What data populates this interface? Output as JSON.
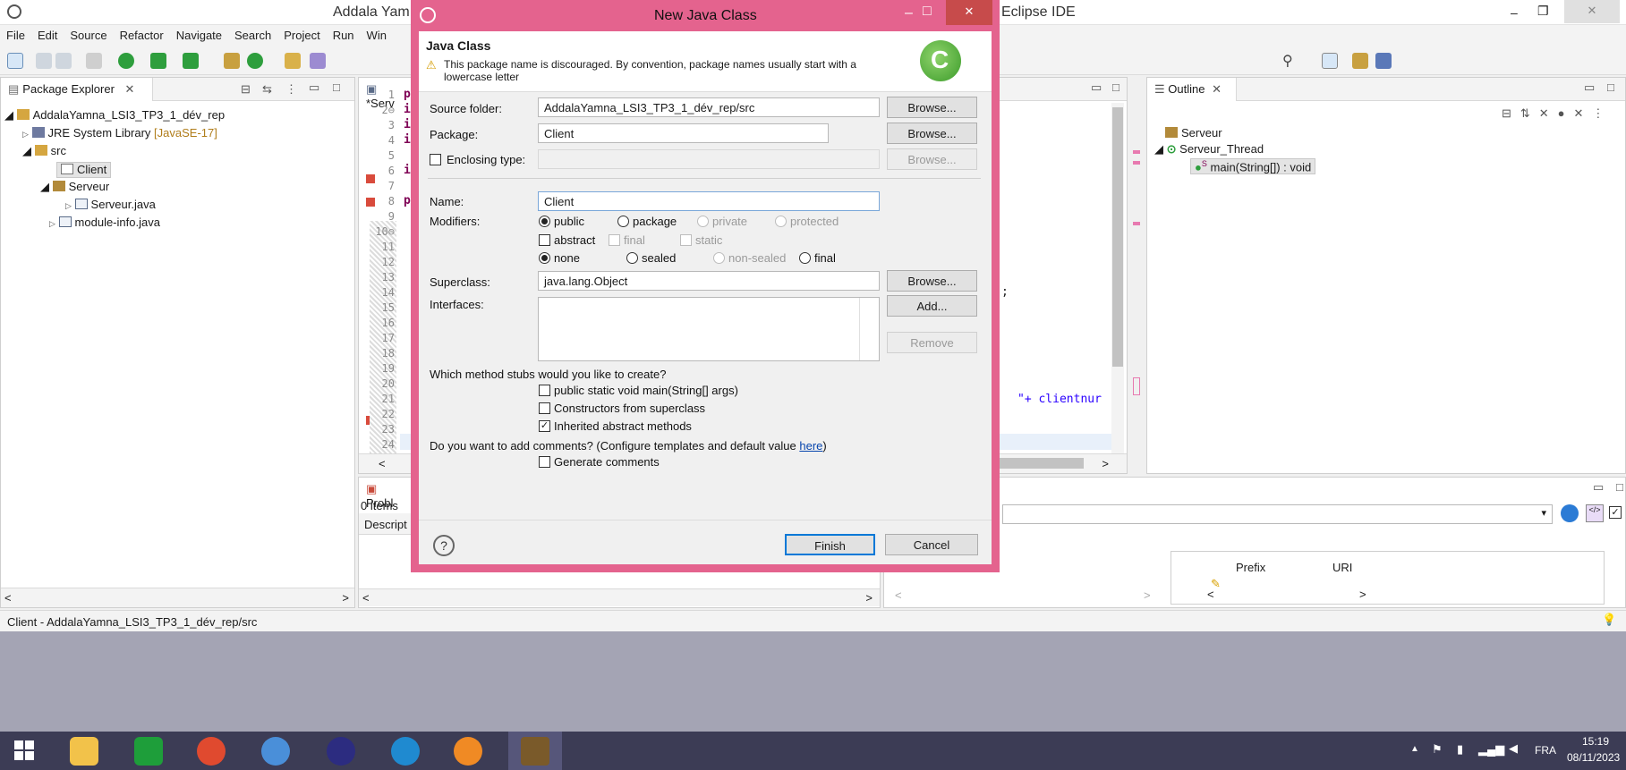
{
  "window": {
    "title_left": "Addala Yam",
    "title_right": "Eclipse IDE"
  },
  "menu": [
    "File",
    "Edit",
    "Source",
    "Refactor",
    "Navigate",
    "Search",
    "Project",
    "Run",
    "Win"
  ],
  "package_explorer": {
    "tab": "Package Explorer",
    "tree": {
      "project": "AddalaYamna_LSI3_TP3_1_dév_rep",
      "jre": "JRE System Library",
      "jre_version": "[JavaSE-17]",
      "src": "src",
      "pkg_client": "Client",
      "pkg_serveur": "Serveur",
      "file_serveur": "Serveur.java",
      "file_module": "module-info.java"
    }
  },
  "editor": {
    "tab": "*Serv",
    "line_numbers": [
      "1",
      "2⊖",
      "3",
      "4",
      "5",
      "6",
      "7",
      "8",
      "9",
      "10⊖",
      "11",
      "12",
      "13",
      "14",
      "15",
      "16",
      "17",
      "18",
      "19",
      "20",
      "21",
      "22",
      "23",
      "24",
      "25"
    ],
    "frag_1": "p",
    "frag_2": "i",
    "frag_3": "i",
    "frag_4": "i",
    "frag_6": "i",
    "frag_8": "p",
    "frag_semicolon": ";",
    "frag_clientnum": "\"+ clientnur"
  },
  "problems": {
    "tab": "Probl",
    "count": "0 items",
    "column": "Descript"
  },
  "outline": {
    "tab": "Outline",
    "items": [
      "Serveur",
      "Serveur_Thread",
      "main(String[]) : void"
    ]
  },
  "bottom_right": {
    "col_prefix": "Prefix",
    "col_uri": "URI"
  },
  "status": {
    "text": "Client - AddalaYamna_LSI3_TP3_1_dév_rep/src"
  },
  "dialog": {
    "title": "New Java Class",
    "header": "Java Class",
    "warning": "This package name is discouraged. By convention, package names usually start with a",
    "warning_2": "lowercase letter",
    "source_folder_label": "Source folder:",
    "source_folder_value": "AddalaYamna_LSI3_TP3_1_dév_rep/src",
    "package_label": "Package:",
    "package_value": "Client",
    "enclosing_label": "Enclosing type:",
    "browse": "Browse...",
    "name_label": "Name:",
    "name_value": "Client",
    "modifiers_label": "Modifiers:",
    "mod_public": "public",
    "mod_package": "package",
    "mod_private": "private",
    "mod_protected": "protected",
    "mod_abstract": "abstract",
    "mod_final": "final",
    "mod_static": "static",
    "mod_none": "none",
    "mod_sealed": "sealed",
    "mod_nonsealed": "non-sealed",
    "mod_final2": "final",
    "superclass_label": "Superclass:",
    "superclass_value": "java.lang.Object",
    "interfaces_label": "Interfaces:",
    "add": "Add...",
    "remove": "Remove",
    "stubs_question": "Which method stubs would you like to create?",
    "stub_main": "public static void main(String[] args)",
    "stub_constructors": "Constructors from superclass",
    "stub_inherited": "Inherited abstract methods",
    "comments_question": "Do you want to add comments? (Configure templates and default value ",
    "comments_link": "here",
    "comments_close": ")",
    "generate_comments": "Generate comments",
    "finish": "Finish",
    "cancel": "Cancel",
    "help": "?"
  },
  "taskbar": {
    "lang": "FRA",
    "time": "15:19",
    "date": "08/11/2023"
  },
  "colors": {
    "dialog_frame": "#e4638e",
    "taskbar": "#3c3c55",
    "accent": "#0078d7"
  }
}
